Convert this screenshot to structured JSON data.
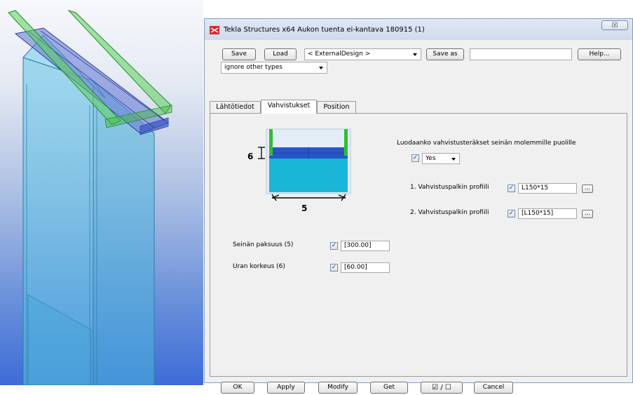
{
  "dialog": {
    "title": "Tekla Structures x64  Aukon tuenta ei-kantava 180915 (1)",
    "close_glyph": "☒"
  },
  "toolbar": {
    "save_label": "Save",
    "load_label": "Load",
    "design_select": "< ExternalDesign >",
    "save_as_label": "Save as",
    "save_as_value": "",
    "help_label": "Help...",
    "type_filter": "ignore other types"
  },
  "tabs": [
    {
      "label": "Lähtötiedot",
      "active": false
    },
    {
      "label": "Vahvistukset",
      "active": true
    },
    {
      "label": "Position",
      "active": false
    }
  ],
  "diagram": {
    "dim_6_label": "6",
    "dim_5_label": "5",
    "colors": {
      "green": "#2fbf2f",
      "blue": "#2a55c8",
      "cyan": "#19b6d8"
    }
  },
  "reinforcement": {
    "question": "Luodaanko vahvistusteräkset seinän molemmille puolille",
    "both_sides_checked": true,
    "both_sides_value": "Yes",
    "profile1_label": "1. Vahvistuspalkin profiili",
    "profile1_checked": true,
    "profile1_value": "L150*15",
    "profile2_label": "2. Vahvistuspalkin profiili",
    "profile2_checked": true,
    "profile2_value": "[L150*15]",
    "ellipsis_label": "..."
  },
  "params": {
    "wall_thickness_label": "Seinän paksuus (5)",
    "wall_thickness_checked": true,
    "wall_thickness_value": "[300.00]",
    "groove_height_label": "Uran korkeus (6)",
    "groove_height_checked": true,
    "groove_height_value": "[60.00]"
  },
  "bottom": {
    "ok_label": "OK",
    "apply_label": "Apply",
    "modify_label": "Modify",
    "get_label": "Get",
    "toggle_label": "☑ / ☐",
    "cancel_label": "Cancel"
  },
  "checkbox_glyph": "✓"
}
